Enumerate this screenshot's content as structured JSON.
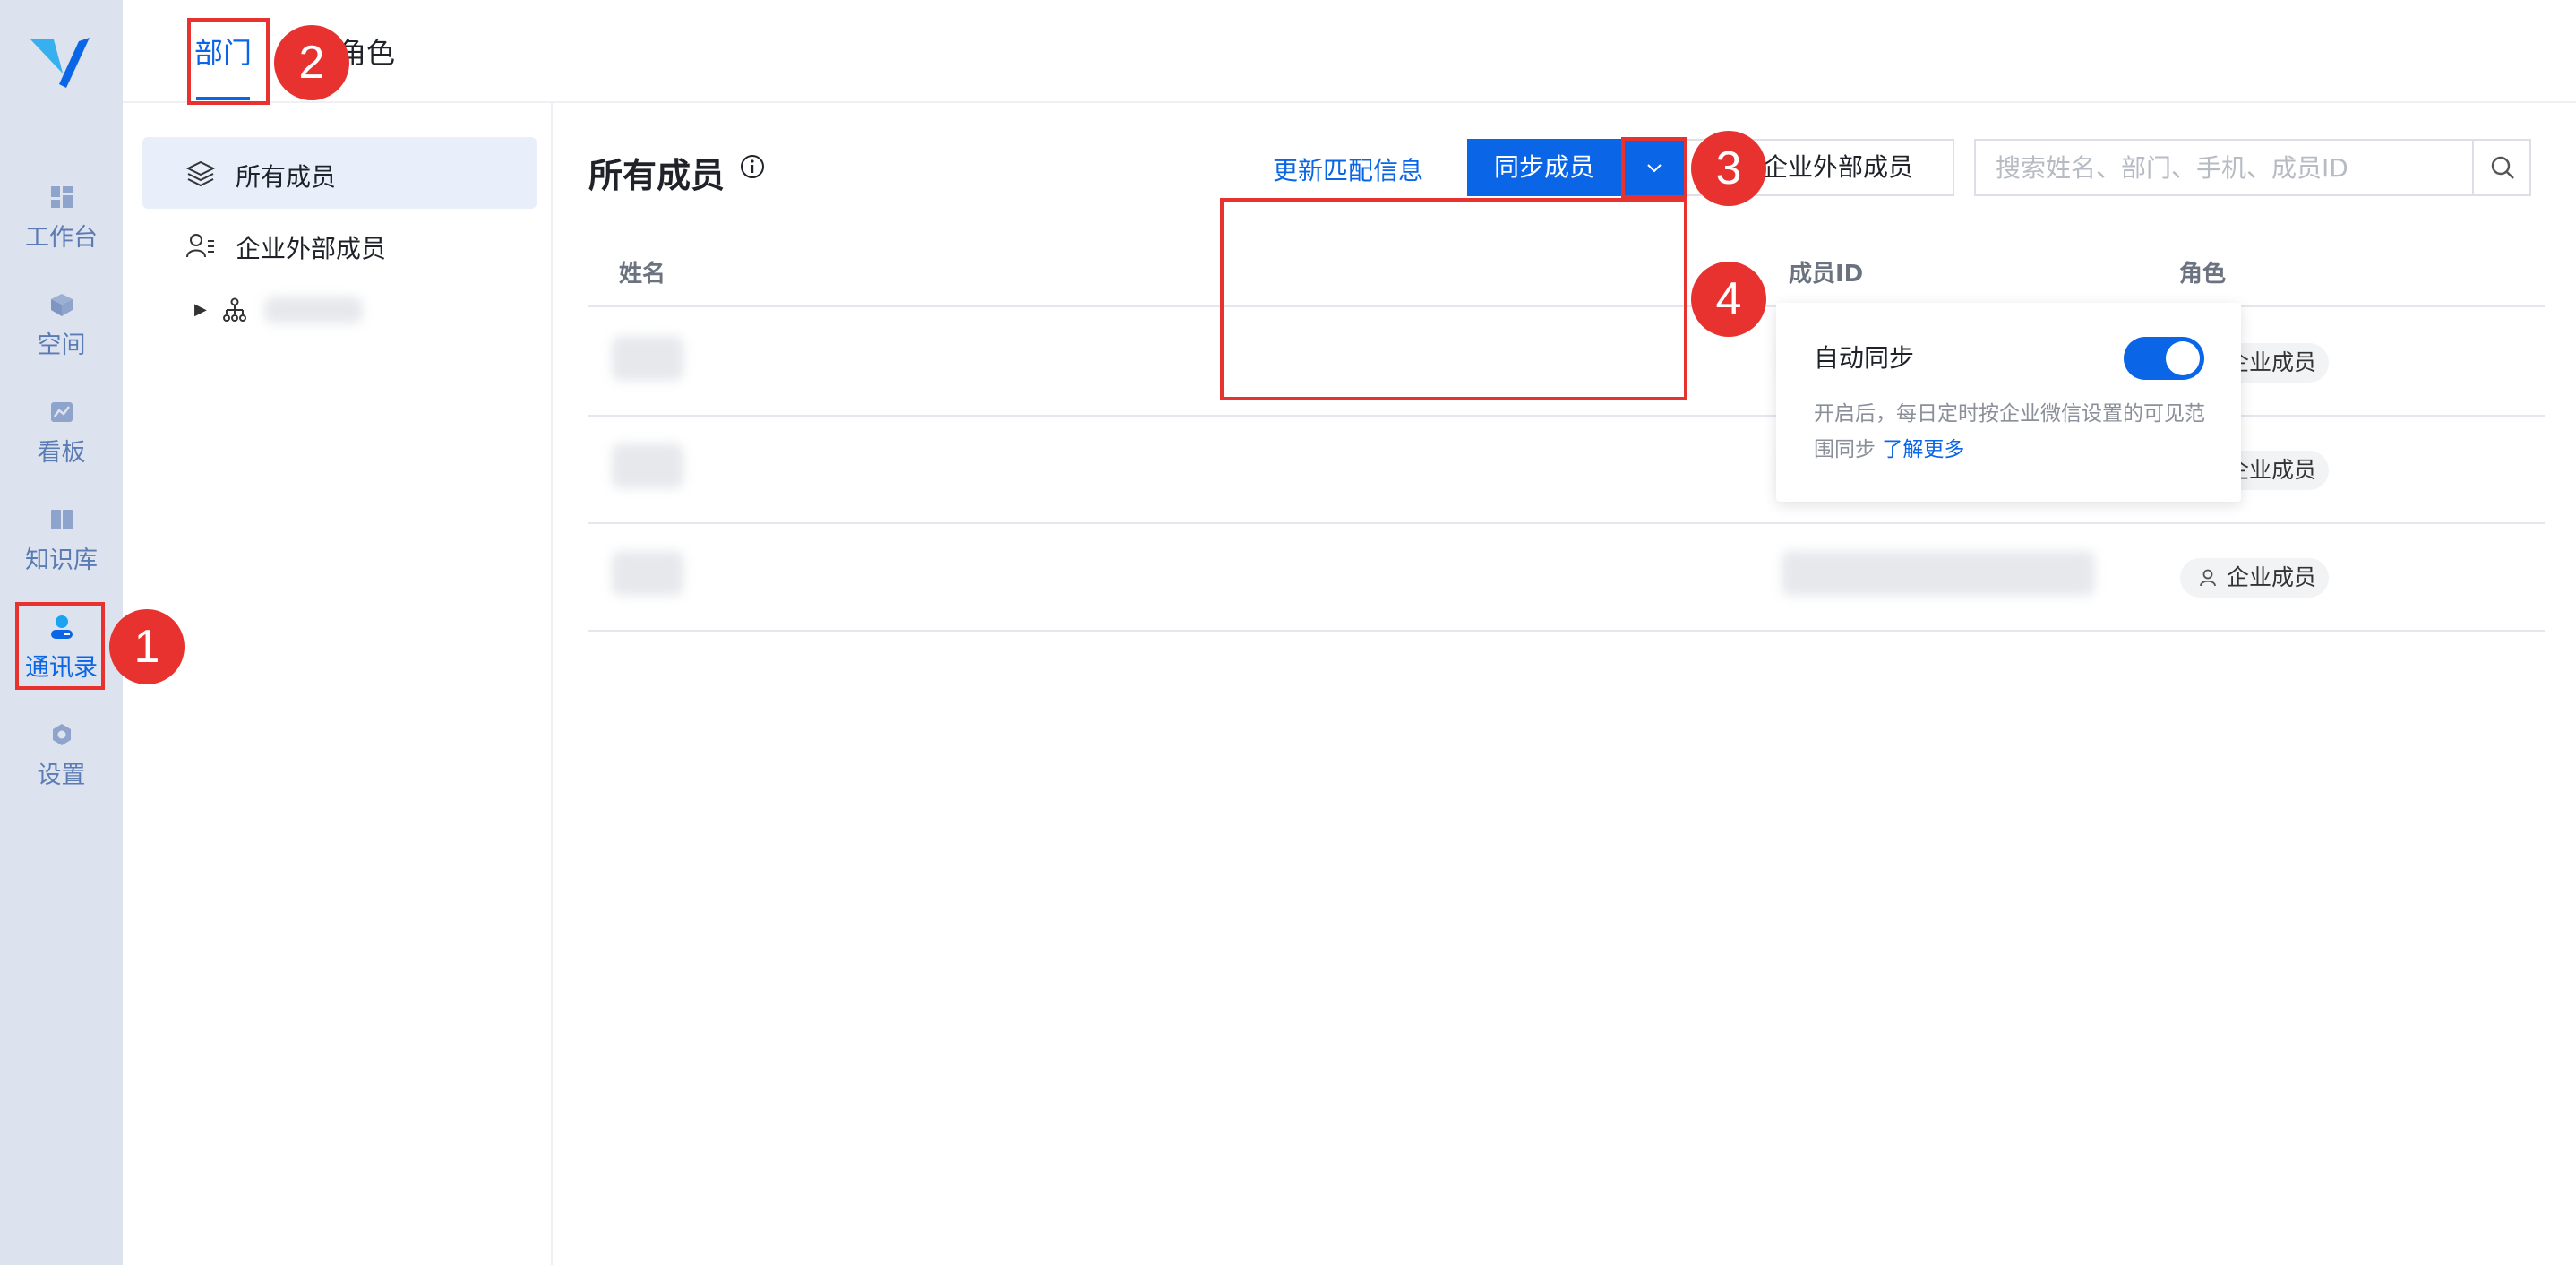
{
  "nav": {
    "items": [
      {
        "label": "工作台",
        "icon": "dashboard-icon"
      },
      {
        "label": "空间",
        "icon": "cube-icon"
      },
      {
        "label": "看板",
        "icon": "chart-board-icon"
      },
      {
        "label": "知识库",
        "icon": "book-icon"
      },
      {
        "label": "通讯录",
        "icon": "contacts-icon"
      },
      {
        "label": "设置",
        "icon": "gear-icon"
      }
    ]
  },
  "tabs": {
    "dept": "部门",
    "role": "角色"
  },
  "sidebar": {
    "items": [
      {
        "label": "所有成员",
        "icon": "layers-icon"
      },
      {
        "label": "企业外部成员",
        "icon": "user-list-icon"
      }
    ]
  },
  "main": {
    "title": "所有成员",
    "update_link": "更新匹配信息",
    "sync_button": "同步成员",
    "invite_button": "邀请企业外部成员",
    "search_placeholder": "搜索姓名、部门、手机、成员ID"
  },
  "table": {
    "columns": {
      "name": "姓名",
      "member_id": "成员ID",
      "role": "角色"
    },
    "rows": [
      {
        "role": "企业成员"
      },
      {
        "role": "企业成员"
      },
      {
        "role": "企业成员"
      }
    ]
  },
  "dropdown": {
    "title": "自动同步",
    "toggle_on": true,
    "desc": "开启后，每日定时按企业微信设置的可见范围同步",
    "link": "了解更多"
  },
  "annotations": [
    "1",
    "2",
    "3",
    "4"
  ],
  "colors": {
    "accent": "#0a66e6",
    "highlight": "#e8322f",
    "rail_bg": "#dde3ee"
  }
}
